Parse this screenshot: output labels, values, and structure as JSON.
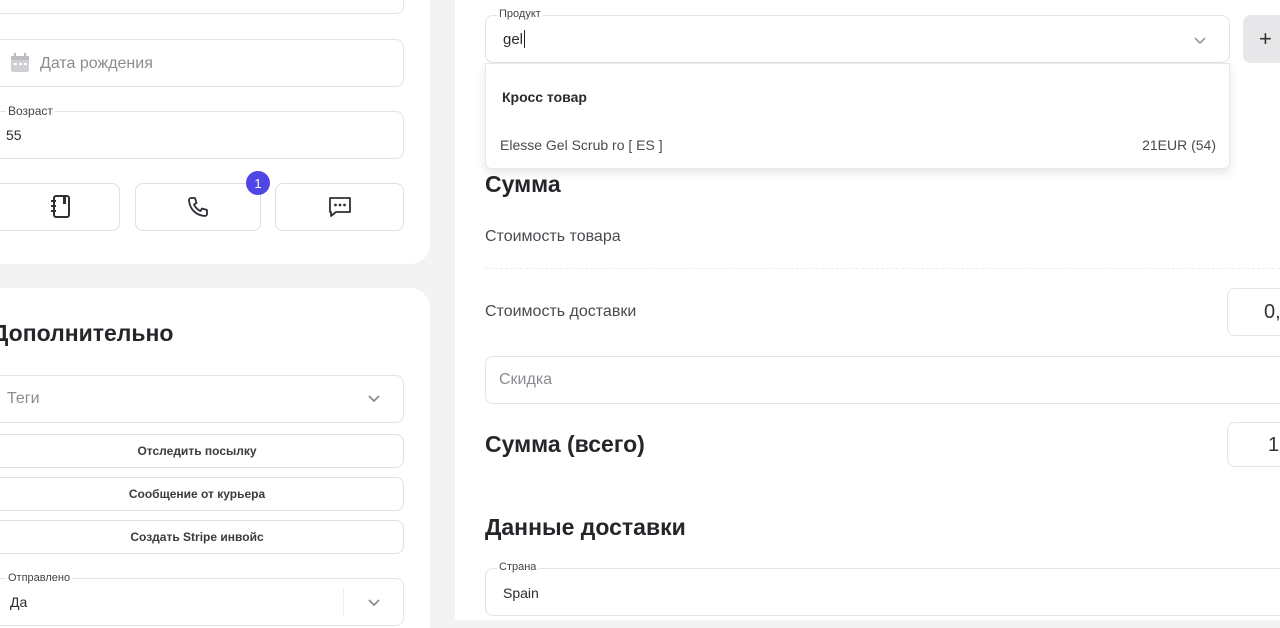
{
  "left": {
    "birthdate_placeholder": "Дата рождения",
    "age_label": "Возраст",
    "age_value": "55",
    "calls_badge": "1",
    "extra_title": "Дополнительно",
    "tags_placeholder": "Теги",
    "track_button": "Отследить посылку",
    "courier_button": "Сообщение от курьера",
    "stripe_button": "Создать Stripe инвойс",
    "sent_label": "Отправлено",
    "sent_value": "Да"
  },
  "right": {
    "product_label": "Продукт",
    "product_input": "gel",
    "add_button": "+",
    "dropdown": {
      "group_title": "Кросс товар",
      "items": [
        {
          "name": "Elesse Gel Scrub ro [ ES ]",
          "price": "21EUR (54)"
        }
      ]
    },
    "sum_title": "Сумма",
    "goods_cost_label": "Стоимость товара",
    "delivery_cost_label": "Стоимость доставки",
    "delivery_cost_value": "0,",
    "discount_placeholder": "Скидка",
    "total_label": "Сумма (всего)",
    "total_value": "1",
    "shipping_title": "Данные доставки",
    "country_label": "Страна",
    "country_value": "Spain"
  },
  "colors": {
    "badge": "#4f46e5",
    "border": "#e4e4e7",
    "background": "#f3f3f4"
  }
}
